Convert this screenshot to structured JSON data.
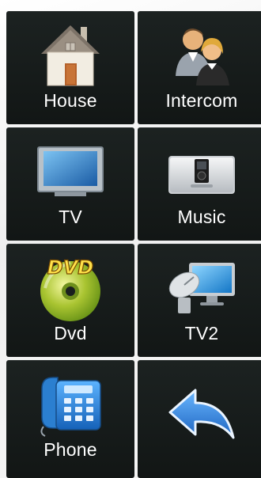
{
  "tiles": [
    {
      "label": "House",
      "icon": "house-icon"
    },
    {
      "label": "Intercom",
      "icon": "people-icon"
    },
    {
      "label": "TV",
      "icon": "tv-icon"
    },
    {
      "label": "Music",
      "icon": "speaker-dock-icon"
    },
    {
      "label": "Dvd",
      "icon": "dvd-disc-icon",
      "badge": "DVD"
    },
    {
      "label": "TV2",
      "icon": "satellite-tv-icon"
    },
    {
      "label": "Phone",
      "icon": "telephone-icon"
    },
    {
      "label": "",
      "icon": "back-arrow-icon"
    }
  ],
  "colors": {
    "tile_background": "#1a1f1e",
    "label_text": "#ffffff",
    "accent_blue": "#2b7fd0"
  }
}
